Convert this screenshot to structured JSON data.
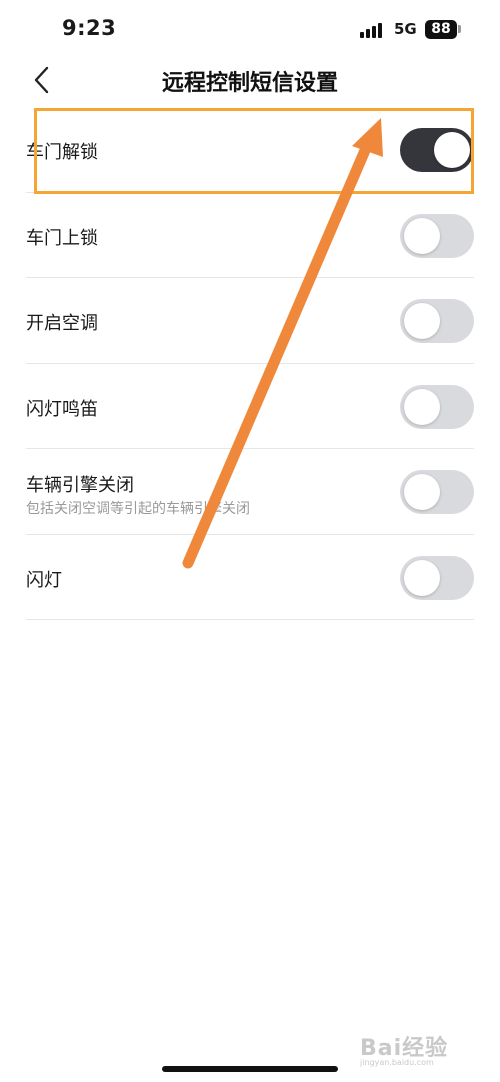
{
  "status_bar": {
    "time": "9:23",
    "network": "5G",
    "battery": "88"
  },
  "nav": {
    "title": "远程控制短信设置"
  },
  "settings": [
    {
      "label": "车门解锁",
      "subtitle": "",
      "enabled": true
    },
    {
      "label": "车门上锁",
      "subtitle": "",
      "enabled": false
    },
    {
      "label": "开启空调",
      "subtitle": "",
      "enabled": false
    },
    {
      "label": "闪灯鸣笛",
      "subtitle": "",
      "enabled": false
    },
    {
      "label": "车辆引擎关闭",
      "subtitle": "包括关闭空调等引起的车辆引擎关闭",
      "enabled": false
    },
    {
      "label": "闪灯",
      "subtitle": "",
      "enabled": false
    }
  ],
  "colors": {
    "toggle_on": "#34363c",
    "toggle_off": "#d9dadd",
    "annotation": "#f5a534"
  },
  "watermark": {
    "text": "Bai经验",
    "url": "jingyan.baidu.com"
  }
}
